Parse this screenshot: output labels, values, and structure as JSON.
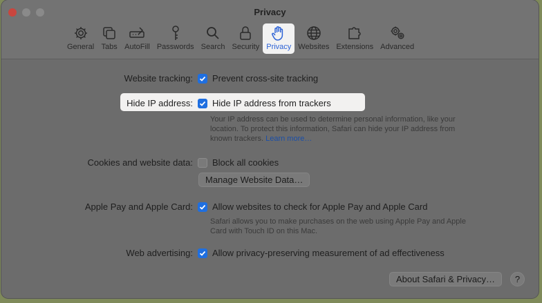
{
  "window": {
    "title": "Privacy"
  },
  "toolbar": {
    "items": [
      {
        "label": "General",
        "icon": "gear-icon"
      },
      {
        "label": "Tabs",
        "icon": "tabs-icon"
      },
      {
        "label": "AutoFill",
        "icon": "autofill-icon"
      },
      {
        "label": "Passwords",
        "icon": "key-icon"
      },
      {
        "label": "Search",
        "icon": "search-icon"
      },
      {
        "label": "Security",
        "icon": "lock-icon"
      },
      {
        "label": "Privacy",
        "icon": "hand-icon",
        "active": true
      },
      {
        "label": "Websites",
        "icon": "globe-icon"
      },
      {
        "label": "Extensions",
        "icon": "puzzle-icon"
      },
      {
        "label": "Advanced",
        "icon": "gears-icon"
      }
    ]
  },
  "settings": {
    "website_tracking": {
      "label": "Website tracking:",
      "option": "Prevent cross-site tracking",
      "checked": true
    },
    "hide_ip": {
      "label": "Hide IP address:",
      "option": "Hide IP address from trackers",
      "checked": true,
      "description": "Your IP address can be used to determine personal information, like your location. To protect this information, Safari can hide your IP address from known trackers.",
      "link": "Learn more…"
    },
    "cookies": {
      "label": "Cookies and website data:",
      "option": "Block all cookies",
      "checked": false,
      "button": "Manage Website Data…"
    },
    "apple_pay": {
      "label": "Apple Pay and Apple Card:",
      "option": "Allow websites to check for Apple Pay and Apple Card",
      "checked": true,
      "description": "Safari allows you to make purchases on the web using Apple Pay and Apple Card with Touch ID on this Mac."
    },
    "web_advertising": {
      "label": "Web advertising:",
      "option": "Allow privacy-preserving measurement of ad effectiveness",
      "checked": true
    }
  },
  "footer": {
    "about_button": "About Safari & Privacy…",
    "help_button": "?"
  },
  "colors": {
    "accent": "#1f6fe0",
    "active_tab_text": "#2c62d6"
  }
}
